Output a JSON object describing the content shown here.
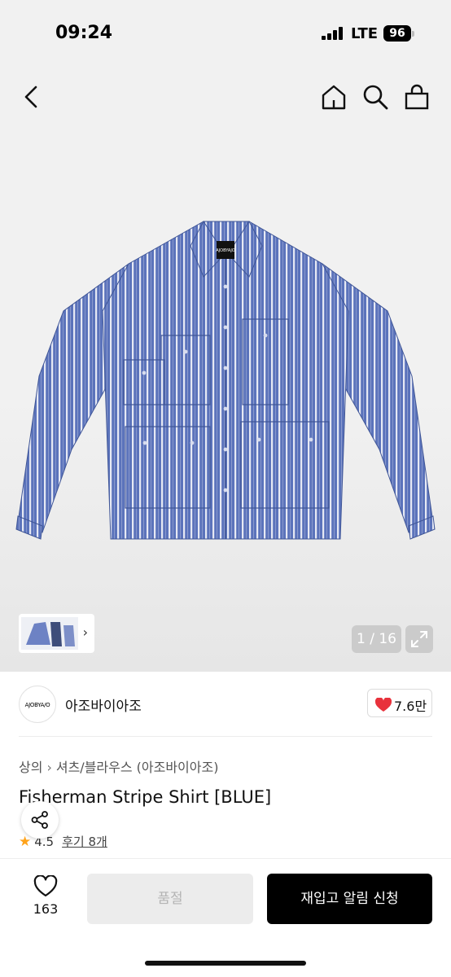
{
  "status_bar": {
    "time": "09:24",
    "network": "LTE",
    "battery": "96"
  },
  "header": {
    "icons": [
      "back-arrow-icon",
      "home-icon",
      "search-icon",
      "shopping-bag-icon"
    ]
  },
  "gallery": {
    "counter": "1 / 16",
    "logo_tag": "AJOBYAJO"
  },
  "brand": {
    "logo_text": "AJOBYA/O",
    "name": "아조바이아조",
    "likes": "7.6만"
  },
  "breadcrumb": {
    "category": "상의",
    "subcategory": "셔츠/블라우스 (아조바이아조)",
    "separator": "›"
  },
  "product": {
    "title": "Fisherman Stripe Shirt [BLUE]",
    "rating": "4.5",
    "reviews": "후기 8개"
  },
  "bottom_bar": {
    "wish_count": "163",
    "soldout_label": "품절",
    "restock_label": "재입고 알림 신청"
  },
  "colors": {
    "accent": "#000000",
    "heart": "#e8323c",
    "star": "#ffa31a",
    "shirt_blue": "#5b73bb"
  }
}
